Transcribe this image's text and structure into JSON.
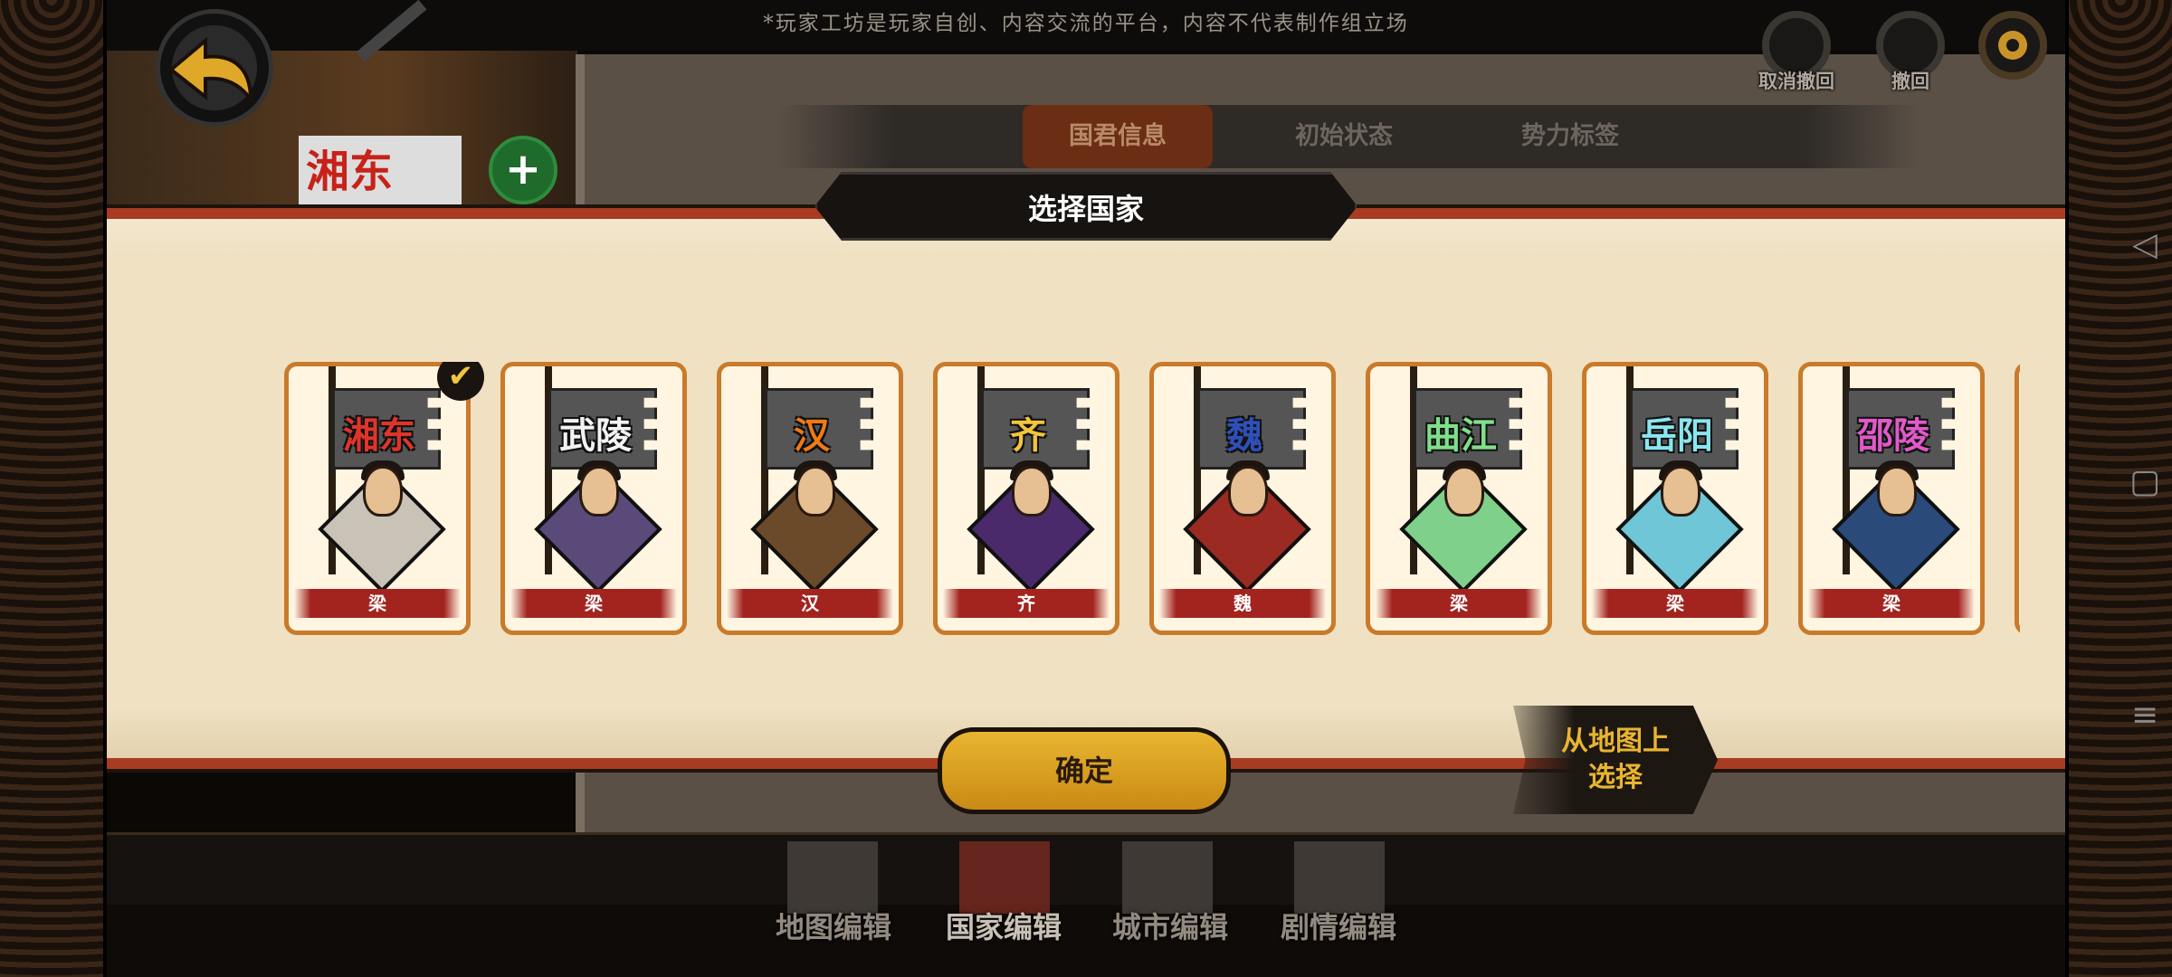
{
  "top_bar": {
    "disclaimer": "*玩家工坊是玩家自创、内容交流的平台，内容不代表制作组立场"
  },
  "toolbar": {
    "undo_cancel_label": "取消撤回",
    "undo_label": "撤回"
  },
  "background": {
    "flag_text": "湘东"
  },
  "tabs": [
    {
      "label": "国君信息",
      "active": true
    },
    {
      "label": "初始状态",
      "active": false
    },
    {
      "label": "势力标签",
      "active": false
    }
  ],
  "modal": {
    "title": "选择国家",
    "confirm_label": "确定",
    "map_select_label_line1": "从地图上",
    "map_select_label_line2": "选择"
  },
  "countries": [
    {
      "name": "湘东",
      "faction": "梁",
      "name_color": "#e0342a",
      "bg_color": "#c9c2b6",
      "selected": true
    },
    {
      "name": "武陵",
      "faction": "梁",
      "name_color": "#f3f3f3",
      "bg_color": "#5a4a7a",
      "selected": false
    },
    {
      "name": "汉",
      "faction": "汉",
      "name_color": "#f07a16",
      "bg_color": "#6b4a2a",
      "selected": false
    },
    {
      "name": "齐",
      "faction": "齐",
      "name_color": "#f3c53a",
      "bg_color": "#4a2a6a",
      "selected": false
    },
    {
      "name": "魏",
      "faction": "魏",
      "name_color": "#2f4fb8",
      "bg_color": "#9a2a22",
      "selected": false
    },
    {
      "name": "曲江",
      "faction": "梁",
      "name_color": "#7fe08a",
      "bg_color": "#7fd08a",
      "selected": false
    },
    {
      "name": "岳阳",
      "faction": "梁",
      "name_color": "#8ae6f0",
      "bg_color": "#6fc6d6",
      "selected": false
    },
    {
      "name": "邵陵",
      "faction": "梁",
      "name_color": "#e05ac8",
      "bg_color": "#2a4a7a",
      "selected": false
    }
  ],
  "bottom_nav": [
    {
      "label": "地图编辑",
      "active": false
    },
    {
      "label": "国家编辑",
      "active": true
    },
    {
      "label": "城市编辑",
      "active": false
    },
    {
      "label": "剧情编辑",
      "active": false
    }
  ],
  "icons": {
    "back": "back-arrow-icon",
    "undo_cancel": "undo-cancel-icon",
    "undo": "undo-icon",
    "settings": "gear-icon",
    "add": "plus-icon",
    "check": "checkmark-icon"
  }
}
